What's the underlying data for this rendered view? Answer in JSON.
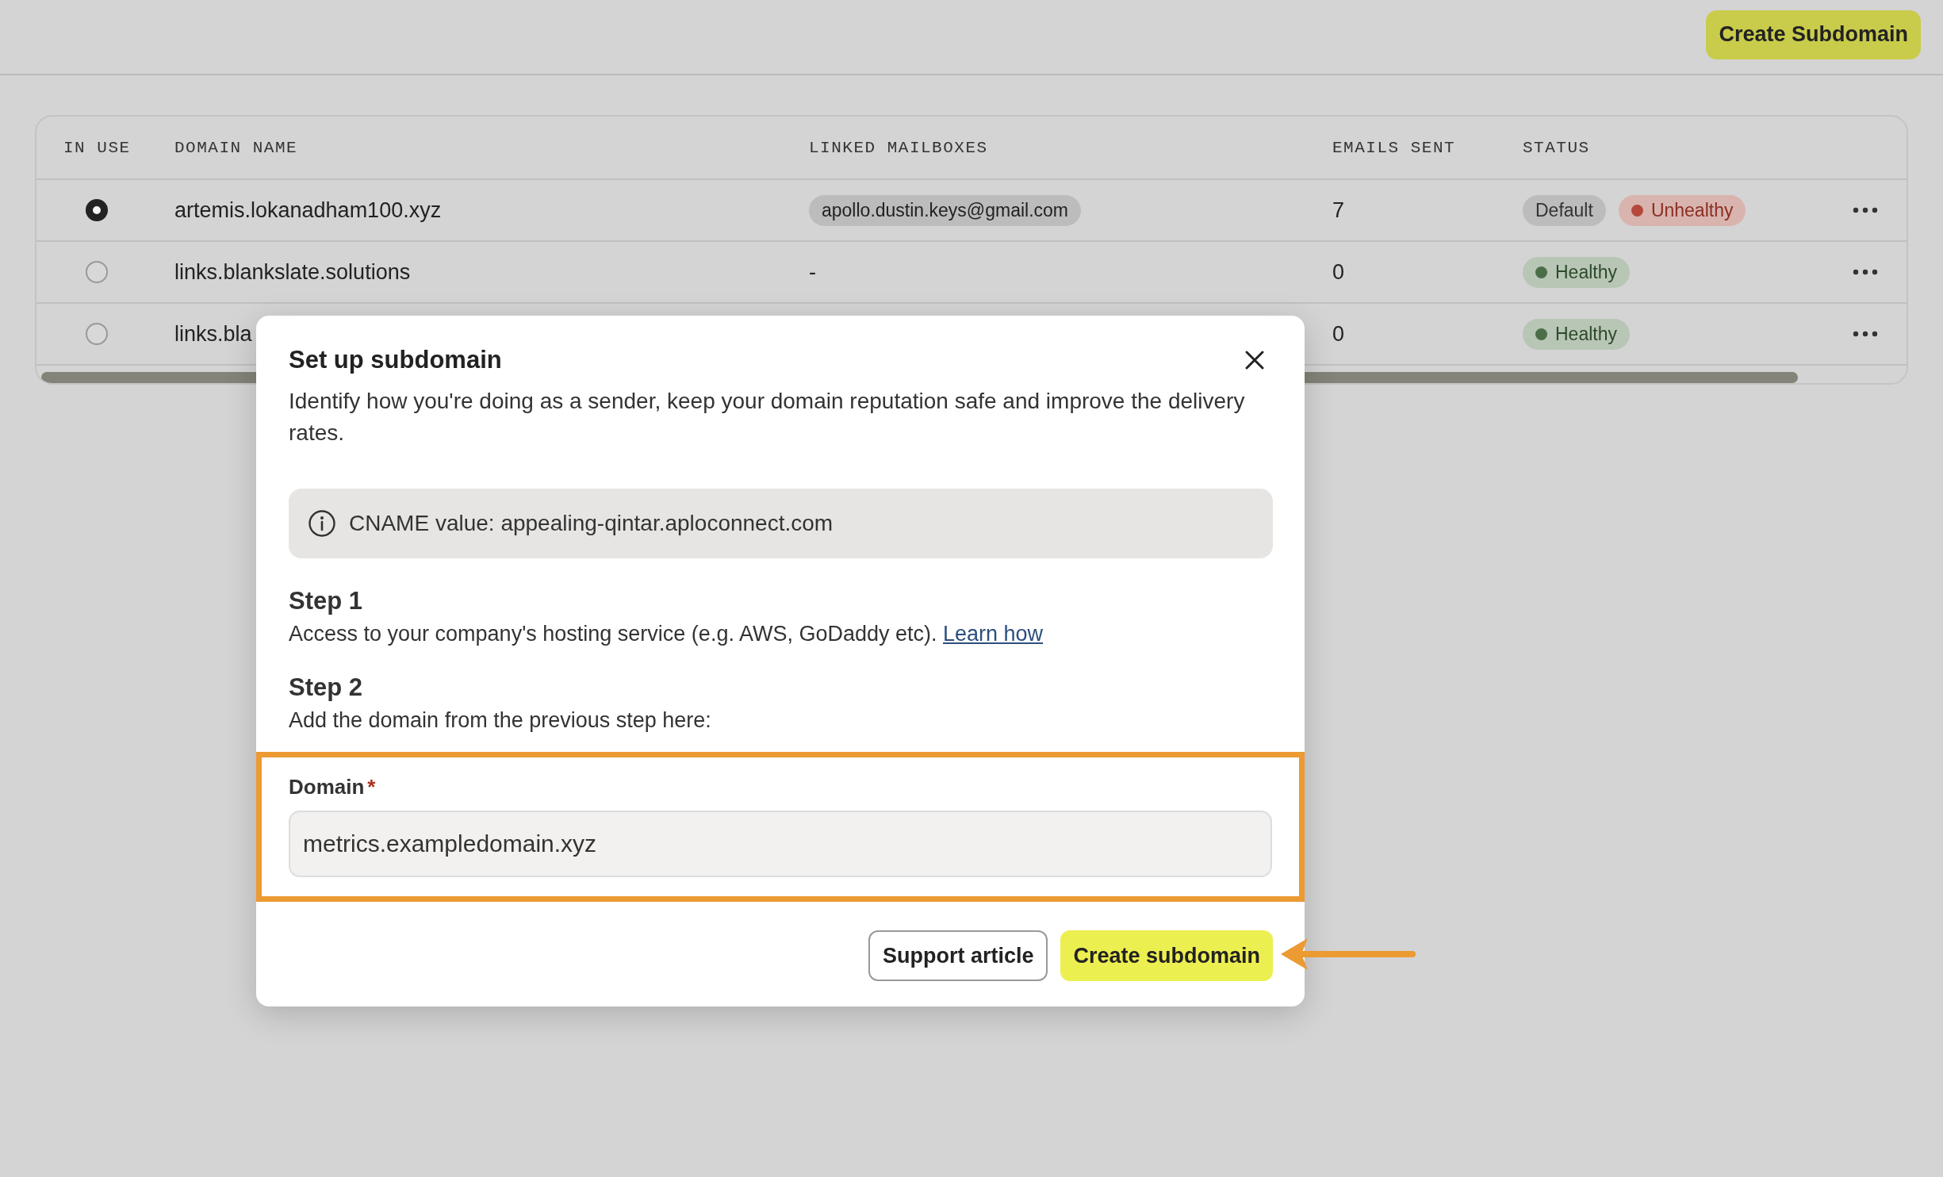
{
  "top_bar": {
    "create_button": "Create Subdomain"
  },
  "table": {
    "columns": [
      "IN USE",
      "DOMAIN NAME",
      "LINKED MAILBOXES",
      "EMAILS SENT",
      "STATUS"
    ],
    "rows": [
      {
        "selected": true,
        "domain": "artemis.lokanadham100.xyz",
        "mailbox": {
          "kind": "chip",
          "text": "apollo.dustin.keys@gmail.com"
        },
        "emails_sent": "7",
        "badges": [
          {
            "kind": "default",
            "label": "Default"
          },
          {
            "kind": "unhealthy",
            "label": "Unhealthy",
            "color": "#b5483b"
          }
        ]
      },
      {
        "selected": false,
        "domain": "links.blankslate.solutions",
        "mailbox": {
          "kind": "plain",
          "text": "-"
        },
        "emails_sent": "0",
        "badges": [
          {
            "kind": "healthy",
            "label": "Healthy",
            "color": "#4a6e48"
          }
        ]
      },
      {
        "selected": false,
        "domain": "links.bla",
        "emails_sent": "0",
        "badges": [
          {
            "kind": "healthy",
            "label": "Healthy",
            "color": "#4a6e48"
          }
        ]
      }
    ]
  },
  "modal": {
    "title": "Set up subdomain",
    "description": "Identify how you're doing as a sender, keep your domain reputation safe and improve the delivery rates.",
    "info": "CNAME value: appealing-qintar.aploconnect.com",
    "steps": [
      {
        "title": "Step 1",
        "text": "Access to your company's hosting service (e.g. AWS, GoDaddy etc). ",
        "link": "Learn how"
      },
      {
        "title": "Step 2",
        "text": "Add the domain from the previous step here:"
      }
    ],
    "field": {
      "label": "Domain",
      "required": true,
      "required_mark": "*",
      "value": "metrics.exampledomain.xyz",
      "highlighted": true
    },
    "buttons": [
      {
        "kind": "secondary",
        "label": "Support article",
        "annotated": false
      },
      {
        "kind": "primary",
        "label": "Create subdomain",
        "annotated": true
      }
    ]
  }
}
